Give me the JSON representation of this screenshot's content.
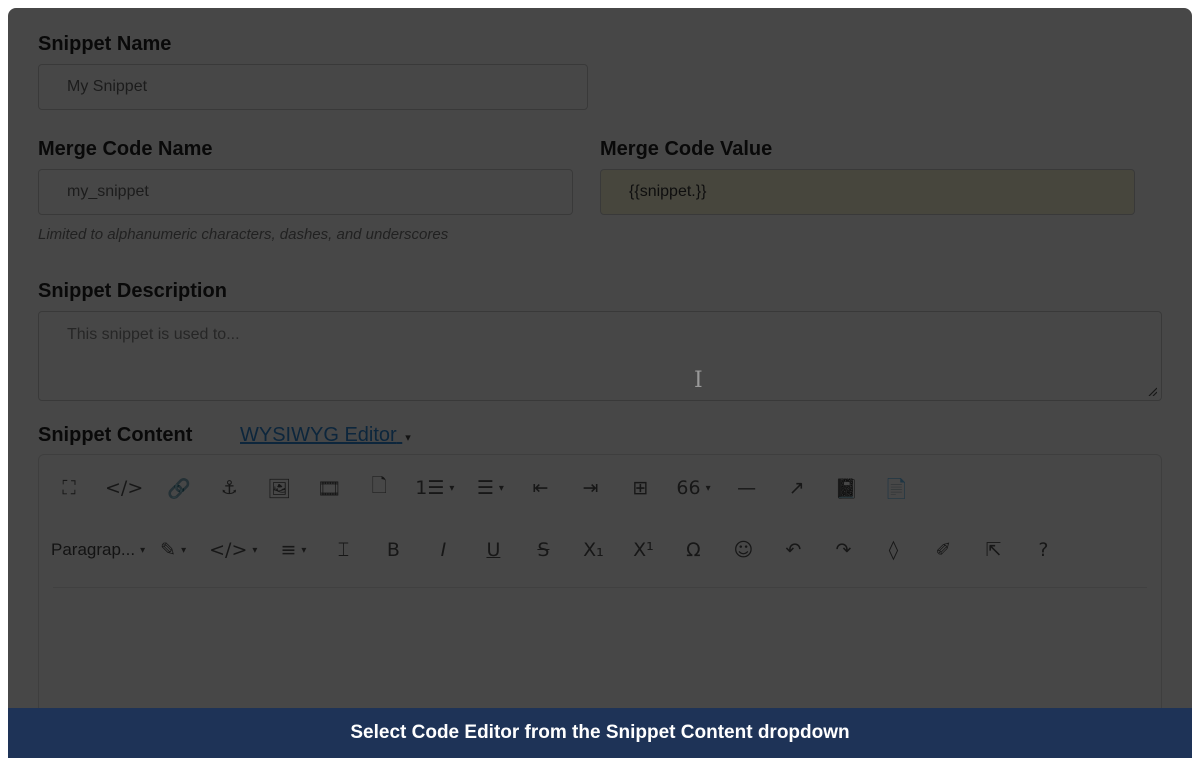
{
  "snippet_name": {
    "label": "Snippet Name",
    "placeholder": "My Snippet"
  },
  "merge_code_name": {
    "label": "Merge Code Name",
    "placeholder": "my_snippet",
    "help": "Limited to alphanumeric characters, dashes, and underscores"
  },
  "merge_code_value": {
    "label": "Merge Code Value",
    "value": "{{snippet.}}"
  },
  "snippet_description": {
    "label": "Snippet Description",
    "placeholder": "This snippet is used to..."
  },
  "snippet_content": {
    "label": "Snippet Content",
    "editor_mode": "WYSIWYG Editor"
  },
  "toolbar": {
    "row1": [
      {
        "name": "fullscreen-icon",
        "glyph": "⛶"
      },
      {
        "name": "source-code-icon",
        "glyph": "</>"
      },
      {
        "name": "link-icon",
        "glyph": "🔗"
      },
      {
        "name": "anchor-icon",
        "glyph": "⚓"
      },
      {
        "name": "image-icon",
        "glyph": "🖼"
      },
      {
        "name": "media-icon",
        "glyph": "🎞"
      },
      {
        "name": "template-icon",
        "glyph": "🗋"
      },
      {
        "name": "numbered-list-icon",
        "glyph": "1☰",
        "dropdown": true
      },
      {
        "name": "bullet-list-icon",
        "glyph": "☰",
        "dropdown": true
      },
      {
        "name": "outdent-icon",
        "glyph": "⇤"
      },
      {
        "name": "indent-icon",
        "glyph": "⇥"
      },
      {
        "name": "table-icon",
        "glyph": "⊞"
      },
      {
        "name": "blockquote-icon",
        "glyph": "66",
        "dropdown": true
      },
      {
        "name": "horizontal-rule-icon",
        "glyph": "—"
      },
      {
        "name": "external-link-icon",
        "glyph": "↗"
      },
      {
        "name": "book-icon",
        "glyph": "📓"
      },
      {
        "name": "document-icon",
        "glyph": "📄"
      }
    ],
    "row2": [
      {
        "name": "highlight-icon",
        "glyph": "✎",
        "dropdown": true
      },
      {
        "name": "code-icon",
        "glyph": "</>",
        "dropdown": true
      },
      {
        "name": "align-icon",
        "glyph": "≡",
        "dropdown": true
      },
      {
        "name": "format-painter-icon",
        "glyph": "⌶"
      },
      {
        "name": "bold-icon",
        "glyph": "B"
      },
      {
        "name": "italic-icon",
        "glyph": "I"
      },
      {
        "name": "underline-icon",
        "glyph": "U"
      },
      {
        "name": "strikethrough-icon",
        "glyph": "S"
      },
      {
        "name": "subscript-icon",
        "glyph": "X₁"
      },
      {
        "name": "superscript-icon",
        "glyph": "X¹"
      },
      {
        "name": "special-char-icon",
        "glyph": "Ω"
      },
      {
        "name": "emoji-icon",
        "glyph": "☺"
      },
      {
        "name": "undo-icon",
        "glyph": "↶"
      },
      {
        "name": "redo-icon",
        "glyph": "↷"
      },
      {
        "name": "color-drop-icon",
        "glyph": "◊"
      },
      {
        "name": "brush-icon",
        "glyph": "✐"
      },
      {
        "name": "select-cursor-icon",
        "glyph": "⇱"
      },
      {
        "name": "help-icon",
        "glyph": "?"
      }
    ],
    "paragraph_label": "Paragrap...",
    "dropdown_glyph": "▾"
  },
  "banner": {
    "text": "Select Code Editor from the Snippet Content dropdown"
  },
  "colors": {
    "overlay": "#000000",
    "banner": "#1e3357",
    "link": "#2f8ad8",
    "readonly": "#fffbdc"
  }
}
